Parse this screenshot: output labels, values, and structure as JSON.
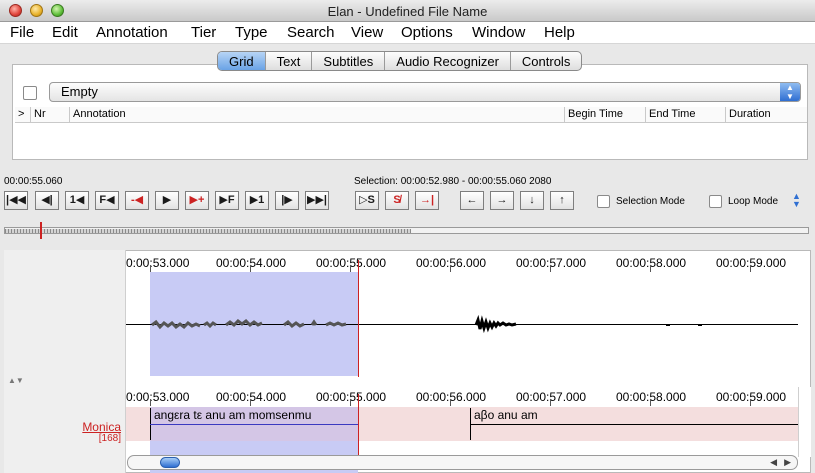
{
  "window": {
    "title": "Elan - Undefined File Name"
  },
  "menu": [
    "File",
    "Edit",
    "Annotation",
    "Tier",
    "Type",
    "Search",
    "View",
    "Options",
    "Window",
    "Help"
  ],
  "tabs": [
    {
      "label": "Grid",
      "active": true
    },
    {
      "label": "Text",
      "active": false
    },
    {
      "label": "Subtitles",
      "active": false
    },
    {
      "label": "Audio Recognizer",
      "active": false
    },
    {
      "label": "Controls",
      "active": false
    }
  ],
  "grid": {
    "tier_select": "Empty",
    "columns": [
      ">",
      "Nr",
      "Annotation",
      "Begin Time",
      "End Time",
      "Duration"
    ]
  },
  "media": {
    "current_time": "00:00:55.060",
    "selection_text": "Selection: 00:00:52.980 - 00:00:55.060  2080"
  },
  "transport": {
    "buttons": [
      {
        "name": "go-to-begin-button",
        "icon": "go-to-begin-icon",
        "glyph": "|◀◀"
      },
      {
        "name": "previous-frame-block-button",
        "icon": "skip-back-icon",
        "glyph": "◀|"
      },
      {
        "name": "previous-second-button",
        "icon": "step-back-second-icon",
        "glyph": "1◀"
      },
      {
        "name": "previous-frame-button",
        "icon": "step-back-frame-icon",
        "glyph": "F◀"
      },
      {
        "name": "previous-pixel-button",
        "icon": "step-back-pixel-icon",
        "glyph": "-◀"
      },
      {
        "name": "play-button",
        "icon": "play-icon",
        "glyph": "▶"
      },
      {
        "name": "next-pixel-button",
        "icon": "step-forward-pixel-icon",
        "glyph": "▶+"
      },
      {
        "name": "next-frame-button",
        "icon": "step-forward-frame-icon",
        "glyph": "▶F"
      },
      {
        "name": "next-second-button",
        "icon": "step-forward-second-icon",
        "glyph": "▶1"
      },
      {
        "name": "next-frame-block-button",
        "icon": "skip-forward-icon",
        "glyph": "|▶"
      },
      {
        "name": "go-to-end-button",
        "icon": "go-to-end-icon",
        "glyph": "▶▶|"
      }
    ],
    "selection_buttons": [
      {
        "name": "play-selection-button",
        "icon": "play-selection-icon",
        "glyph": "▷S"
      },
      {
        "name": "clear-selection-button",
        "icon": "clear-selection-icon",
        "glyph": "S̸"
      },
      {
        "name": "selection-end-button",
        "icon": "go-to-selection-end-icon",
        "glyph": "→|"
      }
    ],
    "nav_buttons": [
      {
        "name": "prev-annotation-button",
        "icon": "arrow-left-icon",
        "glyph": "←"
      },
      {
        "name": "next-annotation-button",
        "icon": "arrow-right-icon",
        "glyph": "→"
      },
      {
        "name": "tier-down-button",
        "icon": "arrow-down-icon",
        "glyph": "↓"
      },
      {
        "name": "tier-up-button",
        "icon": "arrow-up-icon",
        "glyph": "↑"
      }
    ],
    "selection_mode_label": "Selection Mode",
    "loop_mode_label": "Loop Mode"
  },
  "timeline": {
    "tick_labels": [
      "0:00:53.000",
      "00:00:54.000",
      "00:00:55.000",
      "00:00:56.000",
      "00:00:57.000",
      "00:00:58.000",
      "00:00:59.000"
    ]
  },
  "tier": {
    "name": "Monica",
    "count": "[168]",
    "annotations": [
      {
        "text": "angεra tε anu am momsenmu"
      },
      {
        "text": "aβo anu am"
      }
    ]
  },
  "colors": {
    "selection": "#c8cbf5",
    "cursor": "#cc2222",
    "tier_background": "#f4dede",
    "accent_blue": "#2f6fd2"
  }
}
